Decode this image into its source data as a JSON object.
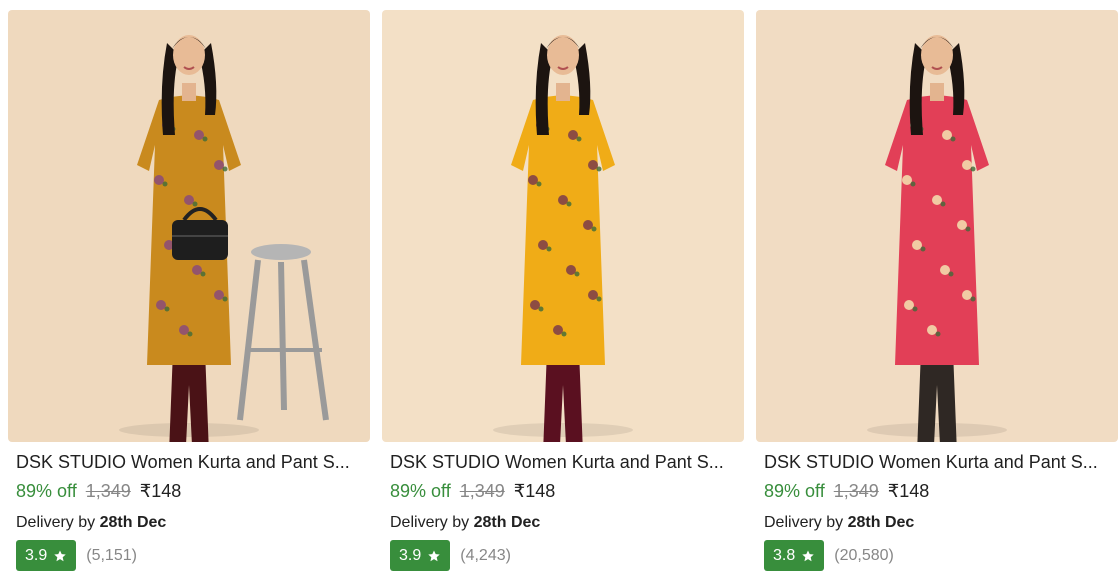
{
  "products": [
    {
      "title": "DSK STUDIO Women Kurta and Pant S...",
      "discount": "89% off",
      "mrp": "1,349",
      "price": "₹148",
      "delivery_prefix": "Delivery by",
      "delivery_date": "28th Dec",
      "rating": "3.9",
      "rating_count": "(5,151)",
      "photo": {
        "background": "#efd9be",
        "kurta_color": "#c98a1e",
        "print_color": "#8a4a7a",
        "pant_color": "#4a1216",
        "props": [
          "handbag",
          "stool"
        ]
      }
    },
    {
      "title": "DSK STUDIO Women Kurta and Pant S...",
      "discount": "89% off",
      "mrp": "1,349",
      "price": "₹148",
      "delivery_prefix": "Delivery by",
      "delivery_date": "28th Dec",
      "rating": "3.9",
      "rating_count": "(4,243)",
      "photo": {
        "background": "#f3e0c6",
        "kurta_color": "#f0ac17",
        "print_color": "#7b3b4a",
        "pant_color": "#5a1020",
        "props": []
      }
    },
    {
      "title": "DSK STUDIO Women Kurta and Pant S...",
      "discount": "89% off",
      "mrp": "1,349",
      "price": "₹148",
      "delivery_prefix": "Delivery by",
      "delivery_date": "28th Dec",
      "rating": "3.8",
      "rating_count": "(20,580)",
      "photo": {
        "background": "#f1dcc3",
        "kurta_color": "#e23f57",
        "print_color": "#f3e3b0",
        "pant_color": "#2f2824",
        "props": []
      }
    }
  ],
  "colors": {
    "discount_green": "#388e3c",
    "rating_badge": "#388e3c",
    "muted_gray": "#878787"
  },
  "icons": {
    "rating": "star-icon"
  }
}
